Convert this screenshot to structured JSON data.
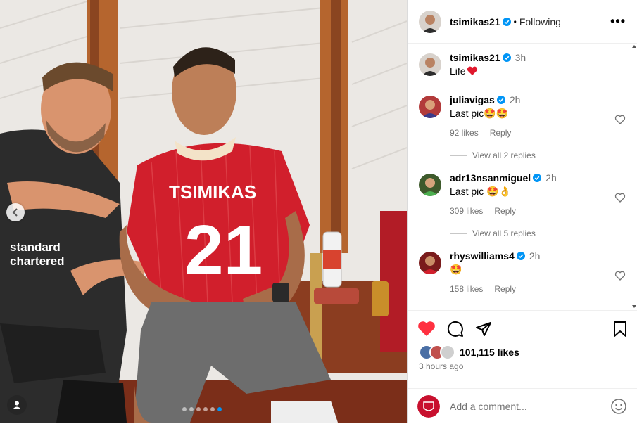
{
  "post": {
    "author": "tsimikas21",
    "follow_status": "Following",
    "caption": "Life",
    "caption_time": "3h",
    "jersey_name": "TSIMIKAS",
    "jersey_number": "21",
    "sponsor_line1": "standard",
    "sponsor_line2": "chartered",
    "carousel_index": 6,
    "carousel_count": 6
  },
  "comments": [
    {
      "user": "juliavigas",
      "time": "2h",
      "text": "Last pic🤩🤩",
      "likes": "92 likes",
      "reply": "Reply",
      "view_replies": "View all 2 replies",
      "avatar_color": "#b23a3a"
    },
    {
      "user": "adr13nsanmiguel",
      "time": "2h",
      "text": "Last pic 🤩👌",
      "likes": "309 likes",
      "reply": "Reply",
      "view_replies": "View all 5 replies",
      "avatar_color": "#3e5a2c"
    },
    {
      "user": "rhyswilliams4",
      "time": "2h",
      "text": "🤩",
      "likes": "158 likes",
      "reply": "Reply",
      "avatar_color": "#7a1c1c"
    }
  ],
  "footer": {
    "likes_count": "101,115 likes",
    "posted_ago": "3 hours ago",
    "comment_placeholder": "Add a comment..."
  },
  "colors": {
    "like_red": "#ff3040",
    "verified_blue": "#0095f6",
    "jersey_red": "#d11f2c"
  }
}
